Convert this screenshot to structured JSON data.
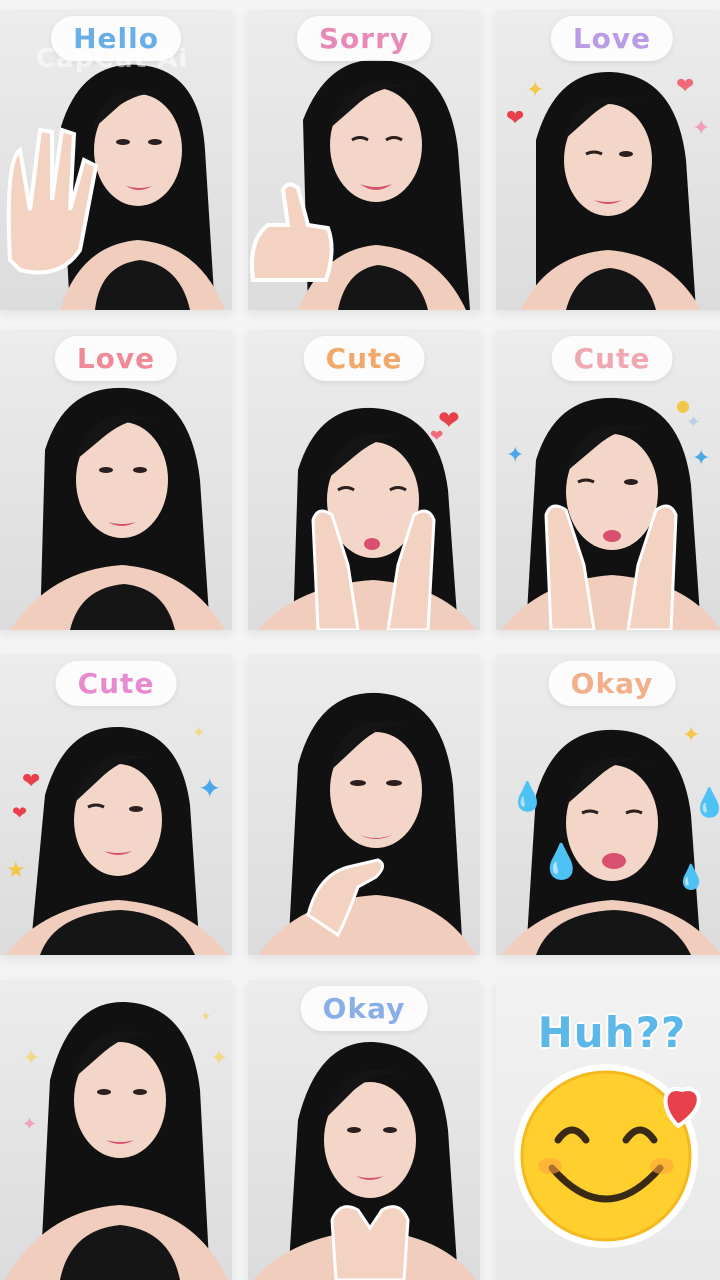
{
  "watermark": "CapCut Ai",
  "colors": {
    "background": "#f4f4f4",
    "bubble_blue": "#6aaee8",
    "bubble_pink": "#e88ab8",
    "bubble_orange": "#f2a86a",
    "huh_blue": "#5cb8e8",
    "heart_red": "#e8404a",
    "emoji_yellow": "#ffcf2e"
  },
  "tiles": [
    {
      "label": "Hello",
      "label_color": "#6aaee8",
      "pose": "wave"
    },
    {
      "label": "Sorry",
      "label_color": "#e88ab8",
      "pose": "thumbs-up"
    },
    {
      "label": "Love",
      "label_color": "#b99be8",
      "pose": "wink"
    },
    {
      "label": "Love",
      "label_color": "#f08a96",
      "pose": "smile"
    },
    {
      "label": "Cute",
      "label_color": "#f2a86a",
      "pose": "cheeks"
    },
    {
      "label": "Cute",
      "label_color": "#f0a8b0",
      "pose": "cheeks-wink"
    },
    {
      "label": "Cute",
      "label_color": "#e88ad0",
      "pose": "wink"
    },
    {
      "label": "",
      "label_color": "",
      "pose": "chin-rest"
    },
    {
      "label": "Okay",
      "label_color": "#f2b08a",
      "pose": "pout"
    },
    {
      "label": "",
      "label_color": "",
      "pose": "smile"
    },
    {
      "label": "Okay",
      "label_color": "#8aaee8",
      "pose": "hands-chin"
    },
    {
      "label": "Huh??",
      "label_color": "#5cb8e8",
      "pose": "emoji"
    }
  ]
}
